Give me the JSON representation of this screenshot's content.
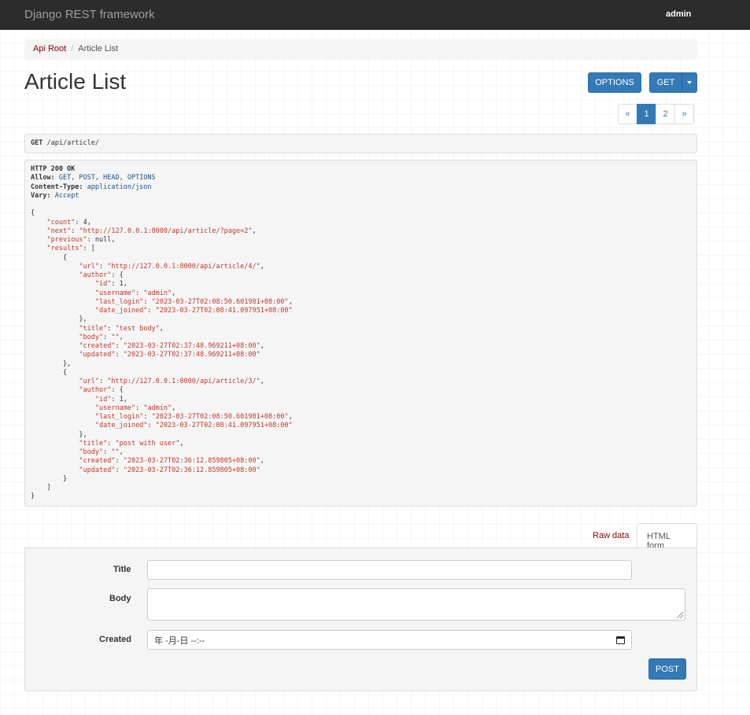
{
  "navbar": {
    "brand": "Django REST framework",
    "user": "admin"
  },
  "breadcrumb": {
    "root": "Api Root",
    "separator": "/",
    "current": "Article List"
  },
  "page": {
    "title": "Article List"
  },
  "buttons": {
    "options": "OPTIONS",
    "get": "GET",
    "post": "POST"
  },
  "pagination": {
    "prev": "«",
    "pages": [
      "1",
      "2"
    ],
    "active_page": "1",
    "next": "»"
  },
  "request": {
    "method": "GET",
    "path": "/api/article/"
  },
  "response": {
    "status": "HTTP 200 OK",
    "headers": [
      {
        "key": "Allow:",
        "value": "GET, POST, HEAD, OPTIONS"
      },
      {
        "key": "Content-Type:",
        "value": "application/json"
      },
      {
        "key": "Vary:",
        "value": "Accept"
      }
    ],
    "body": {
      "count": 4,
      "next": "http://127.0.0.1:8000/api/article/?page=2",
      "previous": null,
      "results": [
        {
          "url": "http://127.0.0.1:8000/api/article/4/",
          "author": {
            "id": 1,
            "username": "admin",
            "last_login": "2023-03-27T02:08:50.601981+08:00",
            "date_joined": "2023-03-27T02:08:41.097951+08:00"
          },
          "title": "test body",
          "body": "",
          "created": "2023-03-27T02:37:48.969211+08:00",
          "updated": "2023-03-27T02:37:48.969211+08:00"
        },
        {
          "url": "http://127.0.0.1:8000/api/article/3/",
          "author": {
            "id": 1,
            "username": "admin",
            "last_login": "2023-03-27T02:08:50.601981+08:00",
            "date_joined": "2023-03-27T02:08:41.097951+08:00"
          },
          "title": "post with user",
          "body": "",
          "created": "2023-03-27T02:36:12.859805+08:00",
          "updated": "2023-03-27T02:36:12.859805+08:00"
        }
      ]
    }
  },
  "tabs": {
    "raw": "Raw data",
    "html": "HTML form",
    "active": "HTML form"
  },
  "form": {
    "title_label": "Title",
    "title_value": "",
    "body_label": "Body",
    "body_value": "",
    "created_label": "Created",
    "created_value": "年 -月-日 --:--"
  },
  "colors": {
    "navbar": "#2c2c2c",
    "primary": "#337ab7",
    "link": "#8b0000",
    "json_string": "#c0392b"
  },
  "icons": {
    "get_dropdown": "caret-down-icon",
    "date_picker": "calendar-icon"
  }
}
